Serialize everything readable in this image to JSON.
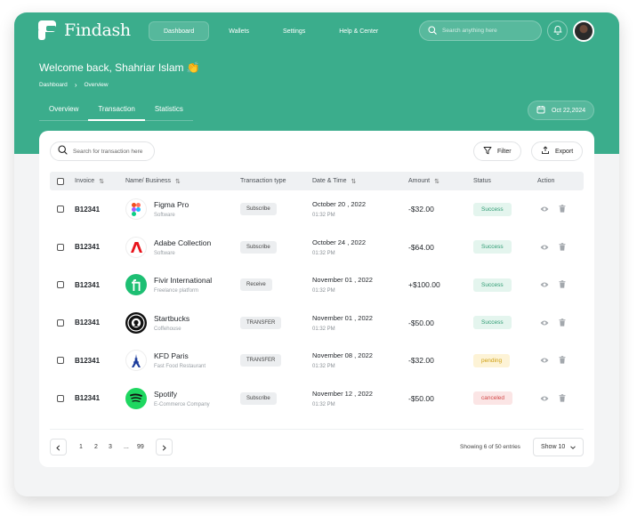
{
  "brand": {
    "name": "Findash",
    "accent": "#3bad8c"
  },
  "nav": [
    {
      "label": "Dashboard",
      "active": true
    },
    {
      "label": "Wallets",
      "active": false
    },
    {
      "label": "Settings",
      "active": false
    },
    {
      "label": "Help & Center",
      "active": false
    }
  ],
  "search": {
    "placeholder": "Search anything here"
  },
  "welcome": "Welcome back, Shahriar Islam 👏",
  "breadcrumb": {
    "home": "Dashboard",
    "current": "Overview"
  },
  "tabs": [
    {
      "label": "Overview",
      "active": false
    },
    {
      "label": "Transaction",
      "active": true
    },
    {
      "label": "Statistics",
      "active": false
    }
  ],
  "date_filter": "Oct 22,2024",
  "table": {
    "search_placeholder": "Search for transaction here",
    "filter_label": "Filter",
    "export_label": "Export",
    "columns": [
      "Invoice",
      "Name/ Business",
      "Transaction type",
      "Date & Time",
      "Amount",
      "Status",
      "Action"
    ],
    "rows": [
      {
        "invoice": "B12341",
        "name": "Figma Pro",
        "category": "Software",
        "type": "Subscribe",
        "date": "October 20 , 2022",
        "time": "01:32 PM",
        "amount": "-$32.00",
        "status": "Success",
        "status_kind": "success",
        "logo": "figma-logo"
      },
      {
        "invoice": "B12341",
        "name": "Adabe Collection",
        "category": "Software",
        "type": "Subscribe",
        "date": "October 24 , 2022",
        "time": "01:32 PM",
        "amount": "-$64.00",
        "status": "Success",
        "status_kind": "success",
        "logo": "adobe-logo"
      },
      {
        "invoice": "B12341",
        "name": "Fivir International",
        "category": "Freelance platform",
        "type": "Receive",
        "date": "November 01 , 2022",
        "time": "01:32 PM",
        "amount": "+$100.00",
        "status": "Success",
        "status_kind": "success",
        "logo": "fiverr-logo"
      },
      {
        "invoice": "B12341",
        "name": "Startbucks",
        "category": "Coffehouse",
        "type": "TRANSFER",
        "date": "November 01 , 2022",
        "time": "01:32 PM",
        "amount": "-$50.00",
        "status": "Success",
        "status_kind": "success",
        "logo": "starbucks-logo"
      },
      {
        "invoice": "B12341",
        "name": "KFD Paris",
        "category": "Fast Food Restaurant",
        "type": "TRANSFER",
        "date": "November 08 , 2022",
        "time": "01:32 PM",
        "amount": "-$32.00",
        "status": "pending",
        "status_kind": "pending",
        "logo": "eiffel-tower-logo"
      },
      {
        "invoice": "B12341",
        "name": "Spotify",
        "category": "E-Commerce Company",
        "type": "Subscribe",
        "date": "November 12 , 2022",
        "time": "01:32 PM",
        "amount": "-$50.00",
        "status": "canceled",
        "status_kind": "canceled",
        "logo": "spotify-logo"
      }
    ]
  },
  "pagination": {
    "pages": [
      "1",
      "2",
      "3",
      "...",
      "99"
    ],
    "showing": "Showing 6 of 50 entries",
    "show_label": "Show 10"
  }
}
